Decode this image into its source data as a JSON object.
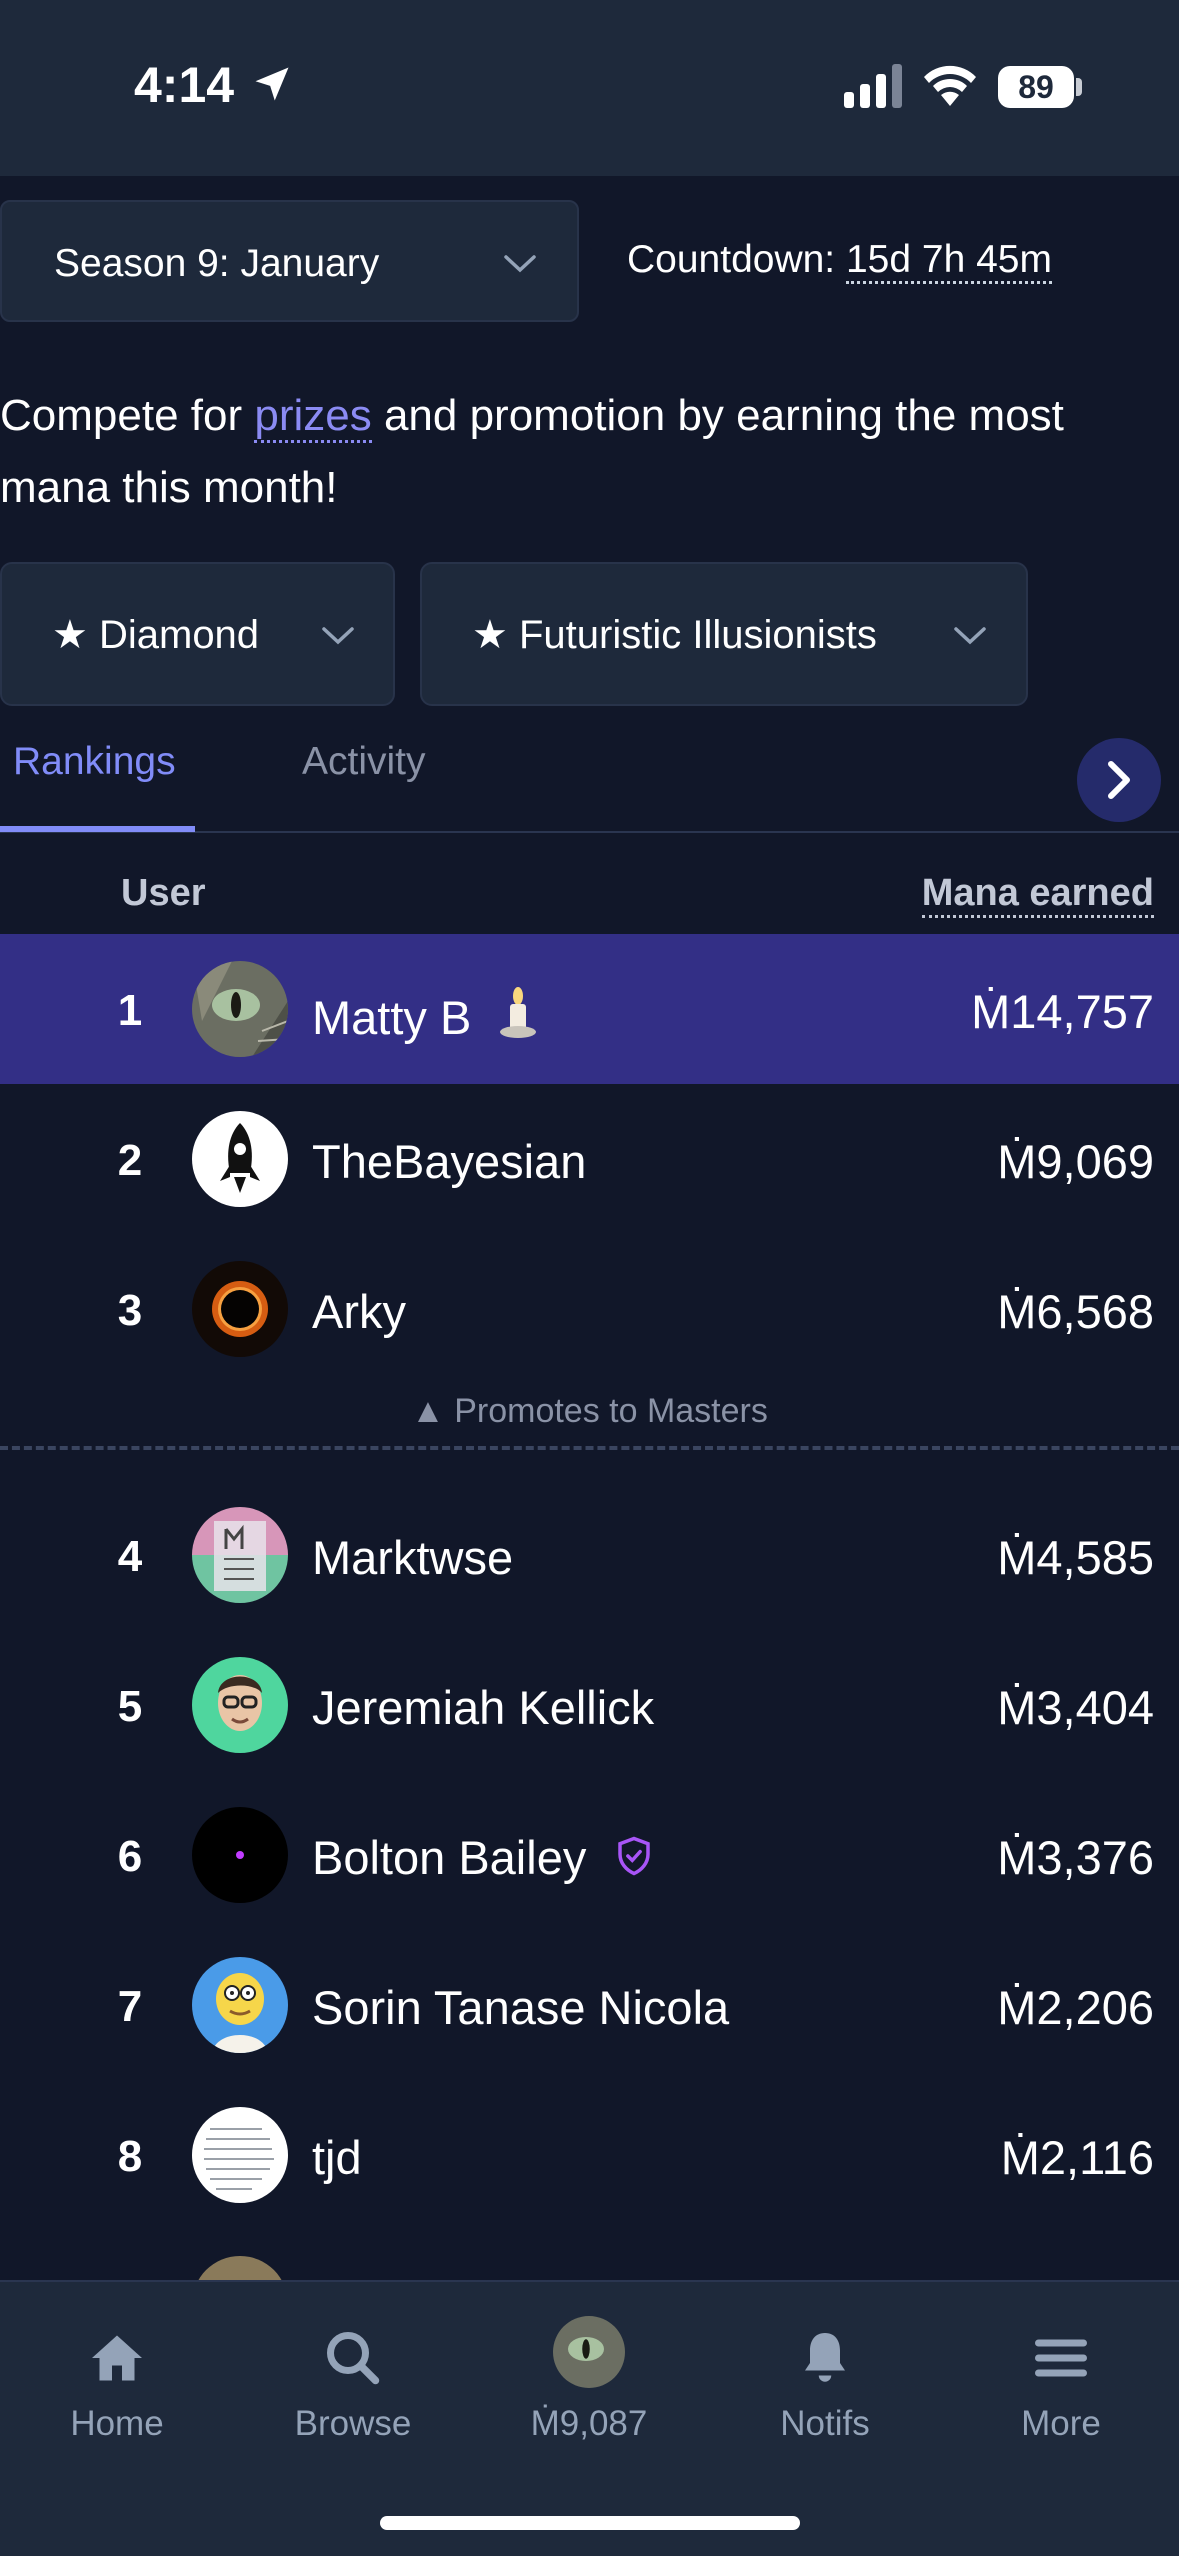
{
  "status_bar": {
    "time": "4:14",
    "battery": "89"
  },
  "season": {
    "select_label": "Season 9: January",
    "countdown_label": "Countdown: ",
    "countdown_value": "15d 7h 45m"
  },
  "intro": {
    "before": "Compete for ",
    "link": "prizes",
    "after": " and promotion by earning the most mana this month!"
  },
  "filters": {
    "division": "★ Diamond",
    "cohort": "★ Futuristic Illusionists"
  },
  "tabs": [
    {
      "label": "Rankings",
      "active": true
    },
    {
      "label": "Activity",
      "active": false
    }
  ],
  "table": {
    "col_user": "User",
    "col_mana": "Mana earned",
    "promote_text": "▲ Promotes to Masters",
    "rows": [
      {
        "rank": "1",
        "name": "Matty B",
        "mana": "Ṁ14,757",
        "badge": "candle-icon"
      },
      {
        "rank": "2",
        "name": "TheBayesian",
        "mana": "Ṁ9,069"
      },
      {
        "rank": "3",
        "name": "Arky",
        "mana": "Ṁ6,568"
      },
      {
        "rank": "4",
        "name": "Marktwse",
        "mana": "Ṁ4,585"
      },
      {
        "rank": "5",
        "name": "Jeremiah Kellick",
        "mana": "Ṁ3,404"
      },
      {
        "rank": "6",
        "name": "Bolton Bailey",
        "mana": "Ṁ3,376",
        "badge": "shield-check-icon"
      },
      {
        "rank": "7",
        "name": "Sorin Tanase Nicola",
        "mana": "Ṁ2,206"
      },
      {
        "rank": "8",
        "name": "tjd",
        "mana": "Ṁ2,116"
      }
    ]
  },
  "bottom_nav": [
    {
      "label": "Home",
      "icon": "home-icon"
    },
    {
      "label": "Browse",
      "icon": "search-icon"
    },
    {
      "label": "Ṁ9,087",
      "icon": "avatar"
    },
    {
      "label": "Notifs",
      "icon": "bell-icon"
    },
    {
      "label": "More",
      "icon": "menu-icon"
    }
  ],
  "colors": {
    "accent": "#818cf8",
    "highlight_row": "#332f86",
    "background": "#111729",
    "panel": "#1e293b"
  }
}
